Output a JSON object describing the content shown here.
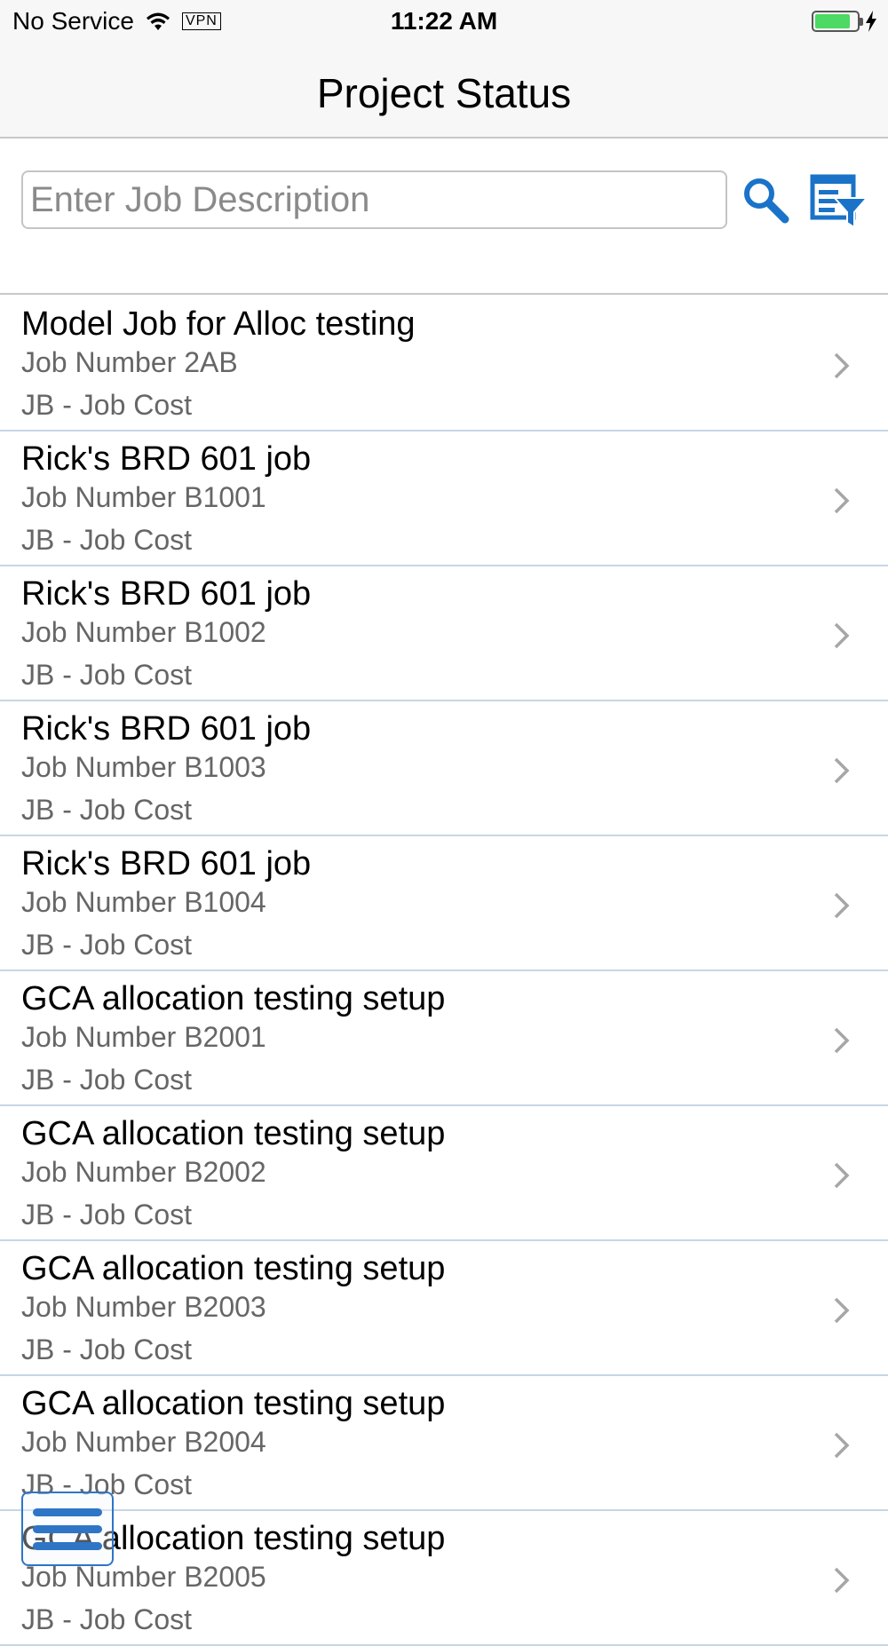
{
  "status_bar": {
    "carrier": "No Service",
    "vpn": "VPN",
    "time": "11:22 AM",
    "battery_level": 0.85
  },
  "header": {
    "title": "Project Status"
  },
  "search": {
    "placeholder": "Enter Job Description",
    "value": ""
  },
  "icons": {
    "search": "search-icon",
    "filter": "filter-icon",
    "menu": "menu-icon",
    "chevron": "chevron-right-icon"
  },
  "colors": {
    "accent": "#1a73c8",
    "menu_accent": "#2e75c6",
    "separator": "#c6d6e6"
  },
  "jobs": [
    {
      "title": "Model Job for Alloc testing",
      "number": "Job Number 2AB",
      "type": "JB - Job Cost"
    },
    {
      "title": "Rick's BRD 601 job",
      "number": "Job Number B1001",
      "type": "JB - Job Cost"
    },
    {
      "title": "Rick's BRD 601 job",
      "number": "Job Number B1002",
      "type": "JB - Job Cost"
    },
    {
      "title": "Rick's BRD 601 job",
      "number": "Job Number B1003",
      "type": "JB - Job Cost"
    },
    {
      "title": "Rick's BRD 601 job",
      "number": "Job Number B1004",
      "type": "JB - Job Cost"
    },
    {
      "title": "GCA allocation testing setup",
      "number": "Job Number B2001",
      "type": "JB - Job Cost"
    },
    {
      "title": "GCA allocation testing setup",
      "number": "Job Number B2002",
      "type": "JB - Job Cost"
    },
    {
      "title": "GCA allocation testing setup",
      "number": "Job Number B2003",
      "type": "JB - Job Cost"
    },
    {
      "title": "GCA allocation testing setup",
      "number": "Job Number B2004",
      "type": "JB - Job Cost"
    },
    {
      "title": "GCA allocation testing setup",
      "number": "Job Number B2005",
      "type": "JB - Job Cost"
    }
  ]
}
